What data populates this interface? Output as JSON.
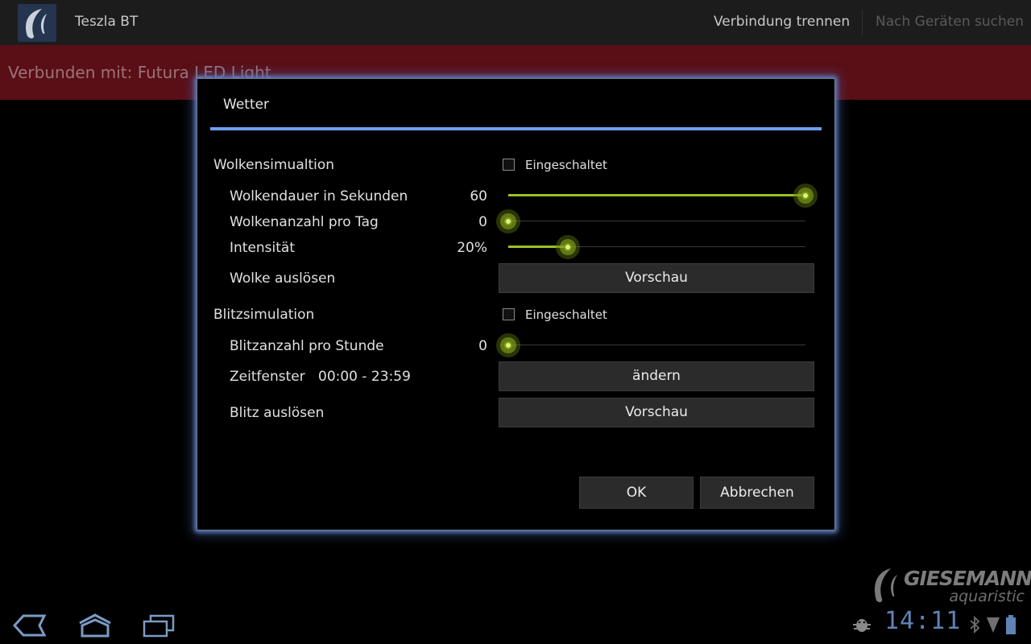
{
  "app": {
    "title": "Teszla BT",
    "actions": {
      "disconnect": "Verbindung trennen",
      "search": "Nach Geräten suchen"
    }
  },
  "banner": {
    "text": "Verbunden mit: Futura LED Light",
    "color": "#5a0e16"
  },
  "dialog": {
    "title": "Wetter",
    "accent_color": "#6e9ef0",
    "cloud": {
      "heading": "Wolkensimualtion",
      "enabled_label": "Eingeschaltet",
      "enabled": false,
      "duration": {
        "label": "Wolkendauer in Sekunden",
        "value": "60",
        "level": 1.0
      },
      "count": {
        "label": "Wolkenanzahl pro Tag",
        "value": "0",
        "level": 0.0
      },
      "intensity": {
        "label": "Intensität",
        "value": "20%",
        "level": 0.2
      },
      "trigger": {
        "label": "Wolke auslösen",
        "button": "Vorschau"
      }
    },
    "lightning": {
      "heading": "Blitzsimulation",
      "enabled_label": "Eingeschaltet",
      "enabled": false,
      "count": {
        "label": "Blitzanzahl pro Stunde",
        "value": "0",
        "level": 0.0
      },
      "window": {
        "label": "Zeitfenster",
        "value": "00:00 - 23:59",
        "button": "ändern"
      },
      "trigger": {
        "label": "Blitz auslösen",
        "button": "Vorschau"
      }
    },
    "ok": "OK",
    "cancel": "Abbrechen"
  },
  "branding": {
    "name": "GIESEMANN",
    "tagline": "aquaristic"
  },
  "system_bar": {
    "clock": "14:11",
    "icons": [
      "back-icon",
      "home-icon",
      "recent-apps-icon",
      "android-debug-icon",
      "bluetooth-icon",
      "signal-icon",
      "battery-icon"
    ]
  }
}
